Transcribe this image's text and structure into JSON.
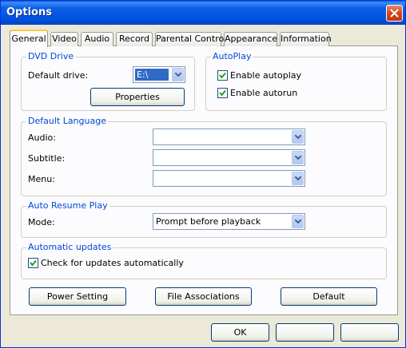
{
  "window": {
    "title": "Options"
  },
  "tabs": [
    "General",
    "Video",
    "Audio",
    "Record",
    "Parental Control",
    "Appearance",
    "Information"
  ],
  "dvd_drive": {
    "legend": "DVD Drive",
    "default_drive_label": "Default drive:",
    "default_drive_value": "E:\\",
    "properties_label": "Properties"
  },
  "autoplay": {
    "legend": "AutoPlay",
    "enable_autoplay_label": "Enable autoplay",
    "enable_autoplay_checked": true,
    "enable_autorun_label": "Enable autorun",
    "enable_autorun_checked": true
  },
  "default_language": {
    "legend": "Default Language",
    "audio_label": "Audio:",
    "audio_value": "",
    "subtitle_label": "Subtitle:",
    "subtitle_value": "",
    "menu_label": "Menu:",
    "menu_value": ""
  },
  "auto_resume": {
    "legend": "Auto Resume Play",
    "mode_label": "Mode:",
    "mode_value": "Prompt before playback"
  },
  "updates": {
    "legend": "Automatic updates",
    "check_label": "Check for updates automatically",
    "check_checked": true
  },
  "actions": {
    "power_setting": "Power Setting",
    "file_associations": "File Associations",
    "default": "Default"
  },
  "footer": {
    "ok": "OK",
    "cancel": "",
    "apply": ""
  },
  "colors": {
    "titlebar": "#0054e3",
    "legend_text": "#0046d5",
    "tab_highlight": "#ffc83c",
    "dialog_bg": "#ece9d8"
  }
}
